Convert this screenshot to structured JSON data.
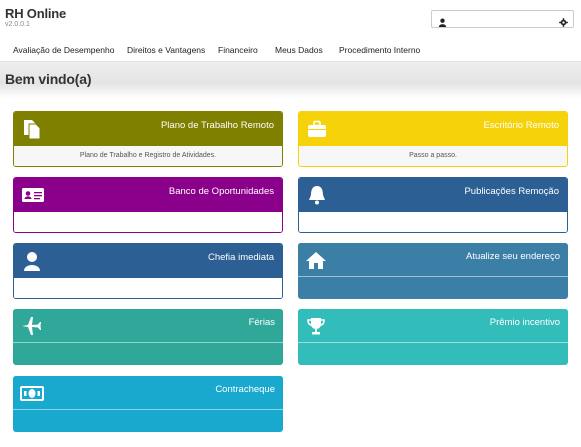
{
  "app": {
    "title": "RH Online",
    "version": "v2.0.0.1"
  },
  "navbar": {
    "items": [
      {
        "label": "Avaliação de Desempenho"
      },
      {
        "label": "Direitos e Vantagens"
      },
      {
        "label": "Financeiro"
      },
      {
        "label": "Meus Dados"
      },
      {
        "label": "Procedimento Interno"
      }
    ]
  },
  "header": {
    "welcome": "Bem vindo(a)"
  },
  "cards": [
    {
      "title": "Plano de Trabalho Remoto",
      "subtitle": "Plano de Trabalho e Registro de Atividades.",
      "icon": "document-icon",
      "color": "#7f7f00"
    },
    {
      "title": "Escritório Remoto",
      "subtitle": "Passo a passo.",
      "icon": "briefcase-icon",
      "color": "#f5d20a"
    },
    {
      "title": "Banco de Oportunidades",
      "subtitle": "",
      "icon": "id-card-icon",
      "color": "#8b008b"
    },
    {
      "title": "Publicações Remoção",
      "subtitle": "",
      "icon": "bell-icon",
      "color": "#2c5f93"
    },
    {
      "title": "Chefia imediata",
      "subtitle": "",
      "icon": "user-icon",
      "color": "#2c5f93"
    },
    {
      "title": "Atualize seu endereço",
      "subtitle": "",
      "icon": "home-icon",
      "color": "#3b7fa6"
    },
    {
      "title": "Férias",
      "subtitle": "",
      "icon": "plane-icon",
      "color": "#2fa89a"
    },
    {
      "title": "Prêmio incentivo",
      "subtitle": "",
      "icon": "trophy-icon",
      "color": "#32bdbb"
    },
    {
      "title": "Contracheque",
      "subtitle": "",
      "icon": "money-icon",
      "color": "#19a9cf"
    }
  ]
}
